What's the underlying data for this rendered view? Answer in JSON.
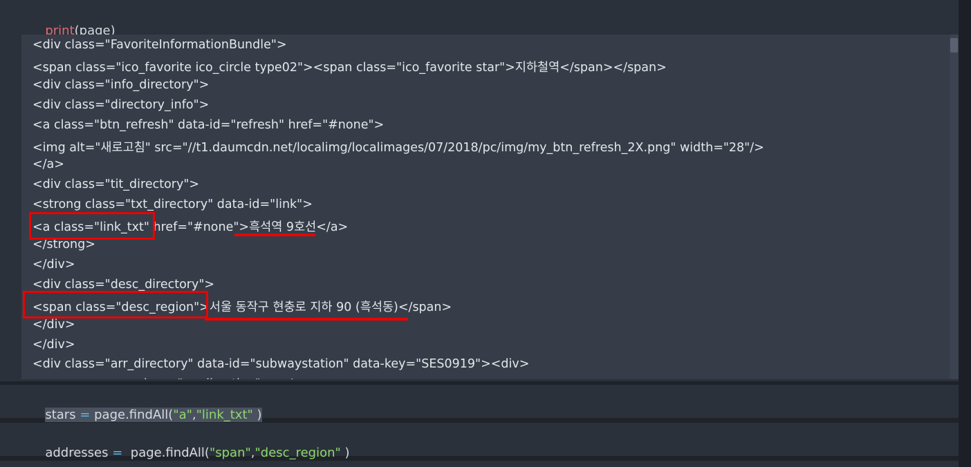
{
  "cell1": {
    "code_fn": "print",
    "code_rest": "(page)"
  },
  "output": {
    "lines": [
      "<div class=\"FavoriteInformationBundle\">",
      "<span class=\"ico_favorite ico_circle type02\"><span class=\"ico_favorite star\">지하철역</span></span>",
      "<div class=\"info_directory\">",
      "<div class=\"directory_info\">",
      "<a class=\"btn_refresh\" data-id=\"refresh\" href=\"#none\">",
      "<img alt=\"새로고침\" src=\"//t1.daumcdn.net/localimg/localimages/07/2018/pc/img/my_btn_refresh_2X.png\" width=\"28\"/>",
      "</a>",
      "<div class=\"tit_directory\">",
      "<strong class=\"txt_directory\" data-id=\"link\">",
      "<a class=\"link_txt\" href=\"#none\">흑석역 9호선</a>",
      "</strong>",
      "</div>",
      "<div class=\"desc_directory\">",
      "<span class=\"desc_region\">서울 동작구 현충로 지하 90 (흑석동)</span>",
      "</div>",
      "</div>",
      "<div class=\"arr_directory\" data-id=\"subwaystation\" data-key=\"SES0919\"><div>",
      "                <span class=\"sc_direction\">  </span>"
    ]
  },
  "cell2": {
    "var": "stars",
    "eq": " = ",
    "call_start": "page.findAll(",
    "arg1": "\"a\"",
    "comma": ",",
    "arg2": "\"link_txt\"",
    "call_end": " )"
  },
  "cell3": {
    "var": "addresses",
    "eq": " = ",
    "call_start": " page.findAll(",
    "arg1": "\"span\"",
    "comma": ",",
    "arg2": "\"desc_region\"",
    "call_end": " )"
  },
  "colors": {
    "cell_bg": "#2b313b",
    "output_bg": "#363d49",
    "highlight": "#ee0000",
    "string": "#8fd86b",
    "keyword_fn": "#e06c75",
    "operator": "#5bb8e8"
  }
}
